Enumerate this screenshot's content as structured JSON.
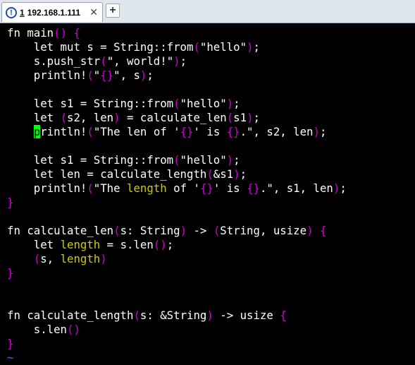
{
  "tab": {
    "info_icon": "!",
    "number": "1",
    "title": "192.168.1.111",
    "close": "✕",
    "new_tab": "+"
  },
  "editor": {
    "lines": [
      [
        [
          "fn main",
          ""
        ],
        [
          "()",
          "p"
        ],
        [
          " ",
          ""
        ],
        [
          "{",
          "p"
        ]
      ],
      [
        [
          "    let mut s = String::from",
          ""
        ],
        [
          "(",
          "p"
        ],
        [
          "\"hello\"",
          ""
        ],
        [
          ")",
          "p"
        ],
        [
          ";",
          ""
        ]
      ],
      [
        [
          "    s.push_str",
          ""
        ],
        [
          "(",
          "p"
        ],
        [
          "\", world!\"",
          ""
        ],
        [
          ")",
          "p"
        ],
        [
          ";",
          ""
        ]
      ],
      [
        [
          "    println!",
          ""
        ],
        [
          "(",
          "p"
        ],
        [
          "\"",
          ""
        ],
        [
          "{}",
          "p"
        ],
        [
          "\", s",
          ""
        ],
        [
          ")",
          "p"
        ],
        [
          ";",
          ""
        ]
      ],
      [],
      [
        [
          "    let s1 = String::from",
          ""
        ],
        [
          "(",
          "p"
        ],
        [
          "\"hello\"",
          ""
        ],
        [
          ")",
          "p"
        ],
        [
          ";",
          ""
        ]
      ],
      [
        [
          "    let ",
          ""
        ],
        [
          "(",
          "p"
        ],
        [
          "s2, len",
          ""
        ],
        [
          ")",
          "p"
        ],
        [
          " = calculate_len",
          ""
        ],
        [
          "(",
          "p"
        ],
        [
          "s1",
          ""
        ],
        [
          ")",
          "p"
        ],
        [
          ";",
          ""
        ]
      ],
      [
        [
          "    ",
          ""
        ],
        [
          "p",
          "c"
        ],
        [
          "rintln!",
          ""
        ],
        [
          "(",
          "p"
        ],
        [
          "\"The len of '",
          ""
        ],
        [
          "{}",
          "p"
        ],
        [
          "' is ",
          ""
        ],
        [
          "{}",
          "p"
        ],
        [
          ".\", s2, len",
          ""
        ],
        [
          ")",
          "p"
        ],
        [
          ";",
          ""
        ]
      ],
      [],
      [
        [
          "    let s1 = String::from",
          ""
        ],
        [
          "(",
          "p"
        ],
        [
          "\"hello\"",
          ""
        ],
        [
          ")",
          "p"
        ],
        [
          ";",
          ""
        ]
      ],
      [
        [
          "    let len = calculate_length",
          ""
        ],
        [
          "(",
          "p"
        ],
        [
          "&s1",
          ""
        ],
        [
          ")",
          "p"
        ],
        [
          ";",
          ""
        ]
      ],
      [
        [
          "    println!",
          ""
        ],
        [
          "(",
          "p"
        ],
        [
          "\"The ",
          ""
        ],
        [
          "length",
          "y"
        ],
        [
          " of '",
          ""
        ],
        [
          "{}",
          "p"
        ],
        [
          "' is ",
          ""
        ],
        [
          "{}",
          "p"
        ],
        [
          ".\", s1, len",
          ""
        ],
        [
          ")",
          "p"
        ],
        [
          ";",
          ""
        ]
      ],
      [
        [
          "}",
          "p"
        ]
      ],
      [],
      [
        [
          "fn calculate_len",
          ""
        ],
        [
          "(",
          "p"
        ],
        [
          "s: String",
          ""
        ],
        [
          ")",
          "p"
        ],
        [
          " -> ",
          ""
        ],
        [
          "(",
          "p"
        ],
        [
          "String, usize",
          ""
        ],
        [
          ")",
          "p"
        ],
        [
          " ",
          ""
        ],
        [
          "{",
          "p"
        ]
      ],
      [
        [
          "    let ",
          ""
        ],
        [
          "length",
          "y"
        ],
        [
          " = s.len",
          ""
        ],
        [
          "()",
          "p"
        ],
        [
          ";",
          ""
        ]
      ],
      [
        [
          "    ",
          ""
        ],
        [
          "(",
          "p"
        ],
        [
          "s, ",
          ""
        ],
        [
          "length",
          "y"
        ],
        [
          ")",
          "p"
        ]
      ],
      [
        [
          "}",
          "p"
        ]
      ],
      [],
      [],
      [
        [
          "fn calculate_length",
          ""
        ],
        [
          "(",
          "p"
        ],
        [
          "s: &String",
          ""
        ],
        [
          ")",
          "p"
        ],
        [
          " -> usize ",
          ""
        ],
        [
          "{",
          "p"
        ]
      ],
      [
        [
          "    s.len",
          ""
        ],
        [
          "()",
          "p"
        ]
      ],
      [
        [
          "}",
          "p"
        ]
      ],
      [
        [
          "~",
          "t"
        ]
      ]
    ]
  }
}
